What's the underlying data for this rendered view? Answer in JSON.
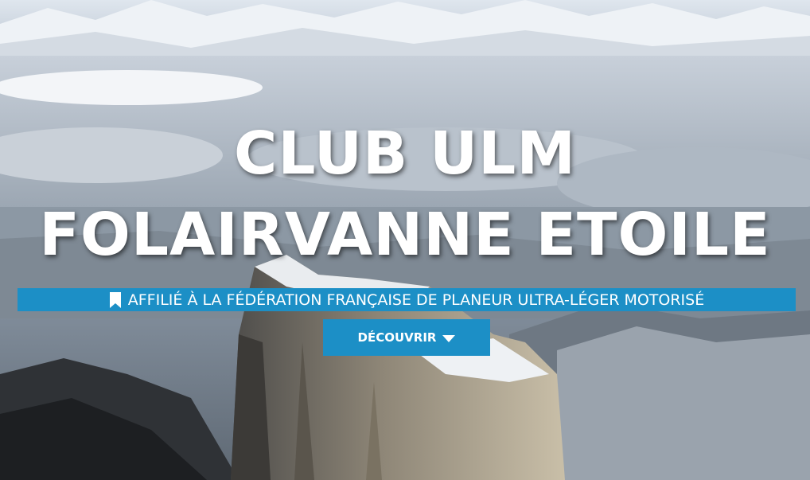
{
  "hero": {
    "title_line1": "CLUB ULM",
    "title_line2": "FOLAIRVANNE ETOILE",
    "tagline": "AFFILIÉ À LA FÉDÉRATION FRANÇAISE DE PLANEUR ULTRA-LÉGER MOTORISÉ",
    "tagline_icon": "bookmark-icon",
    "cta_label": "DÉCOUVRIR",
    "cta_icon": "caret-down-icon",
    "background_image": "snowy-mountain-landscape",
    "accent_color": "#1c8fc6"
  }
}
